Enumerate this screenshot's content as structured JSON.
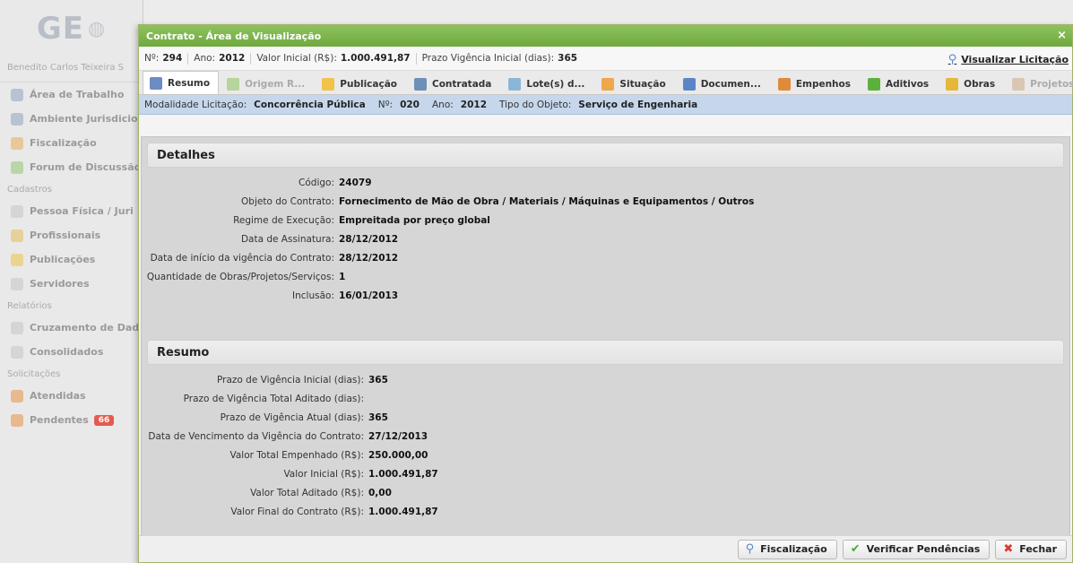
{
  "background": {
    "logo_text": "GE",
    "user_name": "Benedito Carlos Teixeira S",
    "nav": [
      {
        "label": "Área de Trabalho",
        "color": "#b7c3d3"
      },
      {
        "label": "Ambiente Jurisdicio",
        "color": "#b7c3d3"
      },
      {
        "label": "Fiscalização",
        "color": "#e8c79a"
      },
      {
        "label": "Forum de Discussão",
        "color": "#b9d6a6"
      }
    ],
    "section_cadastros": "Cadastros",
    "cadastros": [
      {
        "label": "Pessoa Física / Juri",
        "color": "#d5d5d5"
      },
      {
        "label": "Profissionais",
        "color": "#e7d09a"
      },
      {
        "label": "Publicações",
        "color": "#ead58f"
      },
      {
        "label": "Servidores",
        "color": "#d5d5d5"
      }
    ],
    "section_relatorios": "Relatórios",
    "relatorios": [
      {
        "label": "Cruzamento de Dad",
        "color": "#d5d5d5"
      },
      {
        "label": "Consolidados",
        "color": "#d5d5d5"
      }
    ],
    "section_solicitacoes": "Solicitações",
    "solicitacoes": [
      {
        "label": "Atendidas",
        "color": "#e8b98f"
      },
      {
        "label": "Pendentes",
        "color": "#e8b98f",
        "badge": "66"
      }
    ]
  },
  "modal": {
    "title": "Contrato - Área de Visualização",
    "close_icon": "×",
    "info": {
      "numero_label": "Nº:",
      "numero": "294",
      "ano_label": "Ano:",
      "ano": "2012",
      "valor_label": "Valor Inicial (R$):",
      "valor": "1.000.491,87",
      "prazo_label": "Prazo Vigência Inicial (dias):",
      "prazo": "365",
      "link": "Visualizar Licitação"
    },
    "tabs": [
      {
        "label": "Resumo",
        "icon": "document-icon",
        "color": "#6b8cc4",
        "active": true,
        "disabled": false
      },
      {
        "label": "Origem R...",
        "icon": "origin-icon",
        "color": "#7fbf4e",
        "active": false,
        "disabled": true
      },
      {
        "label": "Publicação",
        "icon": "folder-icon",
        "color": "#f1c34a",
        "active": false,
        "disabled": false
      },
      {
        "label": "Contratada",
        "icon": "people-icon",
        "color": "#6d8fb8",
        "active": false,
        "disabled": false
      },
      {
        "label": "Lote(s) d...",
        "icon": "lot-icon",
        "color": "#8bb7d6",
        "active": false,
        "disabled": false
      },
      {
        "label": "Situação",
        "icon": "status-icon",
        "color": "#f0a64a",
        "active": false,
        "disabled": false
      },
      {
        "label": "Documen...",
        "icon": "documents-icon",
        "color": "#5a86c8",
        "active": false,
        "disabled": false
      },
      {
        "label": "Empenhos",
        "icon": "hammer-icon",
        "color": "#e08a3b",
        "active": false,
        "disabled": false
      },
      {
        "label": "Aditivos",
        "icon": "plus-icon",
        "color": "#5cb03e",
        "active": false,
        "disabled": false
      },
      {
        "label": "Obras",
        "icon": "works-icon",
        "color": "#e6b83a",
        "active": false,
        "disabled": false
      },
      {
        "label": "Projetos",
        "icon": "projects-icon",
        "color": "#c9a37a",
        "active": false,
        "disabled": true
      }
    ],
    "modalidade": {
      "label": "Modalidade Licitação:",
      "value": "Concorrência Pública",
      "numero_label": "Nº:",
      "numero": "020",
      "ano_label": "Ano:",
      "ano": "2012",
      "tipo_label": "Tipo do Objeto:",
      "tipo": "Serviço de Engenharia"
    },
    "detalhes": {
      "title": "Detalhes",
      "rows": [
        {
          "label": "Código:",
          "value": "24079"
        },
        {
          "label": "Objeto do Contrato:",
          "value": "Fornecimento de Mão de Obra / Materiais / Máquinas e Equipamentos / Outros"
        },
        {
          "label": "Regime de Execução:",
          "value": "Empreitada por preço global"
        },
        {
          "label": "Data de Assinatura:",
          "value": "28/12/2012"
        },
        {
          "label": "Data de início da vigência do Contrato:",
          "value": "28/12/2012"
        },
        {
          "label": "Quantidade de Obras/Projetos/Serviços:",
          "value": "1"
        },
        {
          "label": "Inclusão:",
          "value": "16/01/2013"
        }
      ]
    },
    "resumo": {
      "title": "Resumo",
      "rows": [
        {
          "label": "Prazo de Vigência Inicial (dias):",
          "value": "365"
        },
        {
          "label": "Prazo de Vigência Total Aditado (dias):",
          "value": ""
        },
        {
          "label": "Prazo de Vigência Atual (dias):",
          "value": "365"
        },
        {
          "label": "Data de Vencimento da Vigência do Contrato:",
          "value": "27/12/2013"
        },
        {
          "label": "Valor Total Empenhado (R$):",
          "value": "250.000,00"
        },
        {
          "label": "Valor Inicial (R$):",
          "value": "1.000.491,87"
        },
        {
          "label": "Valor Total Aditado (R$):",
          "value": "0,00"
        },
        {
          "label": "Valor Final do Contrato (R$):",
          "value": "1.000.491,87"
        }
      ]
    },
    "buttons": {
      "fiscalizacao": "Fiscalização",
      "verificar": "Verificar Pendências",
      "fechar": "Fechar"
    }
  }
}
